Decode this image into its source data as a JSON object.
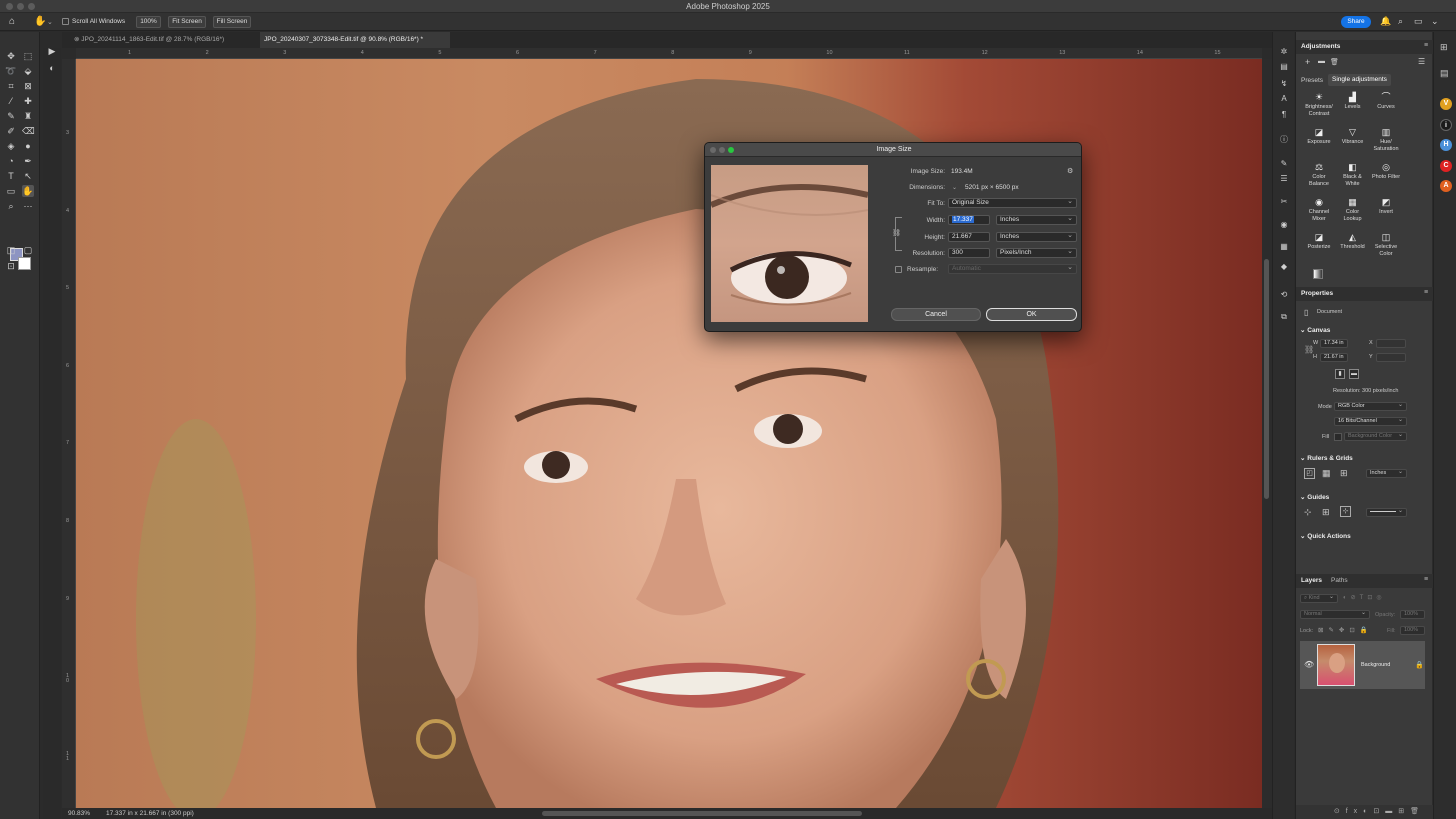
{
  "app": {
    "title": "Adobe Photoshop 2025"
  },
  "options": {
    "scroll_all_label": "Scroll All Windows",
    "zoom_100_label": "100%",
    "fit_screen_label": "Fit Screen",
    "fill_screen_label": "Fill Screen",
    "share_label": "Share"
  },
  "tabs": [
    {
      "label": "JPO_20241114_1863-Edit.tif @ 28.7% (RGB/16*)"
    },
    {
      "label": "JPO_20240307_3073348-Edit.tif @ 90.8% (RGB/16*) *"
    }
  ],
  "ruler": {
    "h_ticks": [
      "1",
      "2",
      "3",
      "4",
      "5",
      "6",
      "7",
      "8",
      "9",
      "10",
      "11",
      "12",
      "13",
      "14",
      "15"
    ],
    "v_ticks": [
      "3",
      "4",
      "5",
      "6",
      "7",
      "8",
      "9",
      "1\n0",
      "1\n1"
    ]
  },
  "status": {
    "zoom": "90.83%",
    "info": "17.337 in x 21.667 in (300 ppi)"
  },
  "dialog": {
    "title": "Image Size",
    "image_size_label": "Image Size:",
    "image_size_value": "193.4M",
    "dimensions_label": "Dimensions:",
    "dimensions_value": "5201 px  ×  6500 px",
    "fit_to_label": "Fit To:",
    "fit_to_value": "Original Size",
    "width_label": "Width:",
    "width_value": "17.337",
    "width_unit": "Inches",
    "height_label": "Height:",
    "height_value": "21.667",
    "height_unit": "Inches",
    "resolution_label": "Resolution:",
    "resolution_value": "300",
    "resolution_unit": "Pixels/Inch",
    "resample_label": "Resample:",
    "resample_value": "Automatic",
    "cancel_label": "Cancel",
    "ok_label": "OK"
  },
  "adjustments": {
    "title": "Adjustments",
    "tab_presets": "Presets",
    "tab_single": "Single adjustments",
    "items": [
      {
        "label": "Brightness/\nContrast",
        "icon": "sun-icon"
      },
      {
        "label": "Levels",
        "icon": "levels-icon"
      },
      {
        "label": "Curves",
        "icon": "curves-icon"
      },
      {
        "label": "Exposure",
        "icon": "exposure-icon"
      },
      {
        "label": "Vibrance",
        "icon": "vibrance-icon"
      },
      {
        "label": "Hue/\nSaturation",
        "icon": "hue-icon"
      },
      {
        "label": "Color\nBalance",
        "icon": "balance-icon"
      },
      {
        "label": "Black &\nWhite",
        "icon": "bw-icon"
      },
      {
        "label": "Photo Filter",
        "icon": "photo-filter-icon"
      },
      {
        "label": "Channel\nMixer",
        "icon": "mixer-icon"
      },
      {
        "label": "Color\nLookup",
        "icon": "lookup-icon"
      },
      {
        "label": "Invert",
        "icon": "invert-icon"
      },
      {
        "label": "Posterize",
        "icon": "posterize-icon"
      },
      {
        "label": "Threshold",
        "icon": "threshold-icon"
      },
      {
        "label": "Selective\nColor",
        "icon": "selective-icon"
      }
    ]
  },
  "properties": {
    "title": "Properties",
    "doc_label": "Document",
    "canvas_label": "Canvas",
    "w_label": "W",
    "w_value": "17.34 in",
    "x_label": "X",
    "h_label": "H",
    "h_value": "21.67 in",
    "y_label": "Y",
    "resolution_text": "Resolution: 300 pixels/inch",
    "mode_label": "Mode",
    "mode_value": "RGB Color",
    "depth_value": "16 Bits/Channel",
    "fill_label": "Fill",
    "fill_value": "Background Color",
    "rulers_label": "Rulers & Grids",
    "rulers_unit": "Inches",
    "guides_label": "Guides",
    "quick_actions_label": "Quick Actions"
  },
  "layers": {
    "tab_layers": "Layers",
    "tab_paths": "Paths",
    "kind_placeholder": "Kind",
    "blend_mode": "Normal",
    "opacity_label": "Opacity:",
    "opacity_value": "100%",
    "lock_label": "Lock:",
    "fill_label": "Fill:",
    "fill_value": "100%",
    "layer_name": "Background"
  },
  "colors": {
    "accent": "#1473e6",
    "canvas_bg": "#c98a62",
    "panel_bg": "#3a3a3a"
  }
}
